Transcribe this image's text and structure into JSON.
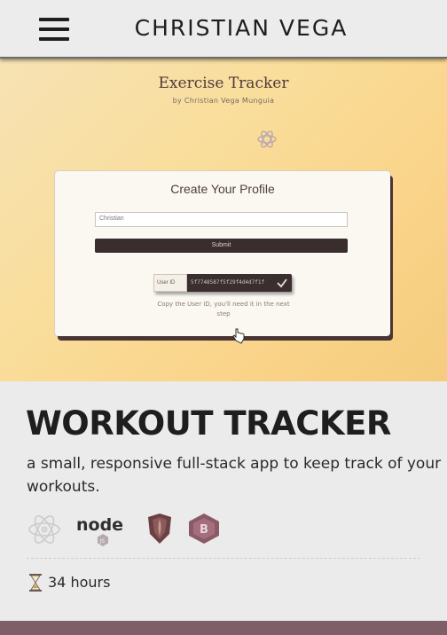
{
  "header": {
    "title": "CHRISTIAN VEGA",
    "menu_icon": "hamburger-menu-icon"
  },
  "preview": {
    "app_title": "Exercise Tracker",
    "byline": "by Christian Vega Munguia",
    "profile_heading": "Create Your Profile",
    "username_value": "Christian",
    "submit_label": "Submit",
    "userid_label": "User ID",
    "userid_value": "5f7748587f5f29f4d4d7f1f",
    "copy_note": "Copy the User ID, you'll need it in the next step"
  },
  "project": {
    "title": "WORKOUT TRACKER",
    "description": "a small, responsive full-stack app to keep track of your workouts.",
    "technologies": [
      "react-icon",
      "node-icon",
      "mongoose-icon",
      "bootstrap-icon"
    ],
    "duration": "34 hours"
  },
  "colors": {
    "background": "#ebebeb",
    "text": "#1e1e1e",
    "hero_gradient_start": "#f7e2b4",
    "hero_gradient_end": "#f5cc7d",
    "card_shadow": "#4a3535",
    "bottom_bar": "#7e5f68"
  }
}
